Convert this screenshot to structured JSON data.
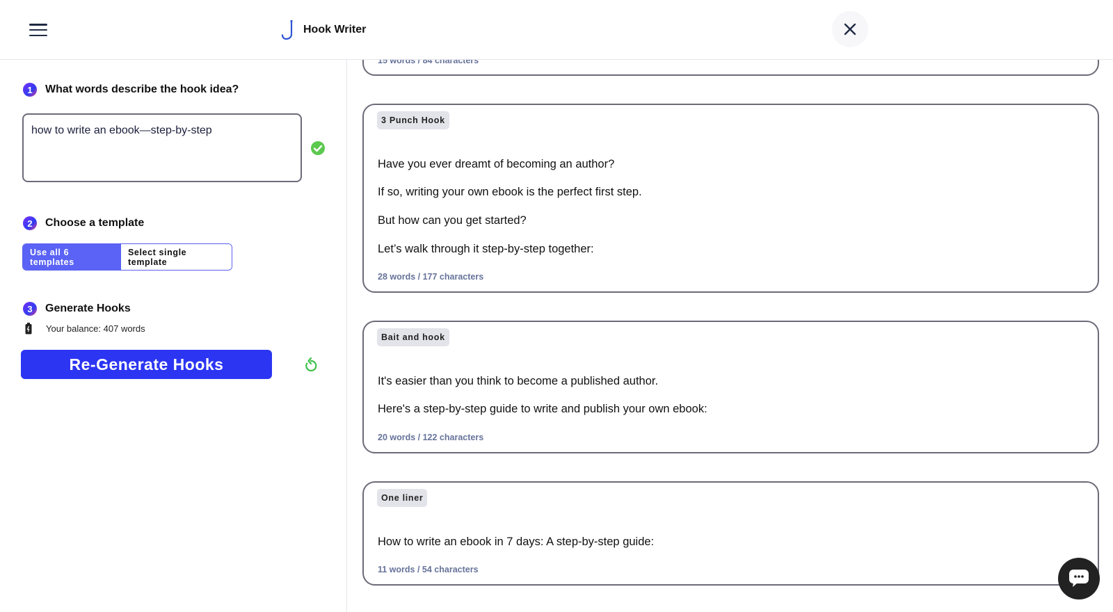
{
  "header": {
    "app_title": "Hook Writer",
    "menu_icon": "hamburger-menu-icon",
    "logo_icon": "fishhook-icon",
    "close_icon": "close-icon"
  },
  "steps": [
    {
      "num": "1",
      "title": "What words describe the hook idea?"
    },
    {
      "num": "2",
      "title": "Choose a template"
    },
    {
      "num": "3",
      "title": "Generate Hooks"
    }
  ],
  "idea_input": {
    "value": "how to write an ebook—step-by-step"
  },
  "templates": {
    "all_label": "Use all 6 templates",
    "single_label": "Select single template"
  },
  "balance": {
    "text": "Your balance: 407 words"
  },
  "generate": {
    "button_label": "Re-Generate Hooks"
  },
  "colors": {
    "accent": "#2b35f2",
    "toggle_active": "#5a63f5",
    "success": "#5cc94f"
  },
  "results": {
    "top_partial_count": "15 words / 84 characters",
    "cards": [
      {
        "badge": "3 Punch Hook",
        "lines": [
          "Have you ever dreamt of becoming an author?",
          "If so, writing your own ebook is the perfect first step.",
          "But how can you get started?",
          "Let’s walk through it step-by-step together:"
        ],
        "count": "28 words / 177 characters"
      },
      {
        "badge": "Bait and hook",
        "lines": [
          "It's easier than you think to become a published author.",
          "Here's a step-by-step guide to write and publish your own ebook:"
        ],
        "count": "20 words / 122 characters"
      },
      {
        "badge": "One liner",
        "lines": [
          "How to write an ebook in 7 days: A step-by-step guide:"
        ],
        "count": "11 words / 54 characters"
      }
    ]
  }
}
